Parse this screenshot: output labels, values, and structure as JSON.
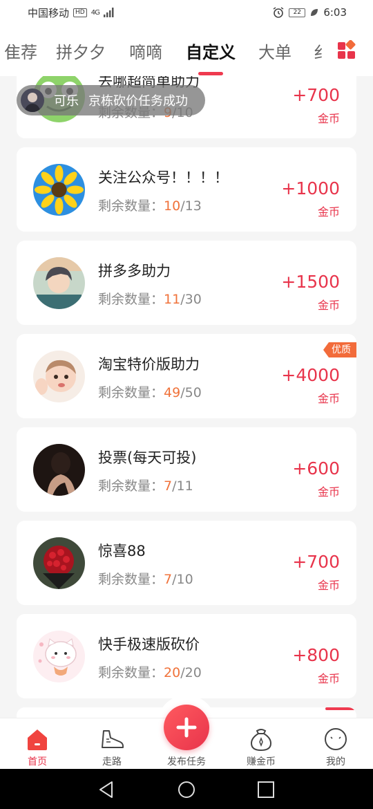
{
  "status_bar": {
    "carrier": "中国移动",
    "hd": "HD",
    "network": "4G",
    "battery": "22",
    "time": "6:03"
  },
  "tabs": [
    {
      "label": "推荐",
      "visible_text": "隹荐"
    },
    {
      "label": "拼夕夕"
    },
    {
      "label": "嘀嘀"
    },
    {
      "label": "自定义",
      "active": true
    },
    {
      "label": "大单"
    },
    {
      "label": "纟"
    }
  ],
  "toast": {
    "user": "可乐",
    "message": "京栋砍价任务成功"
  },
  "tasks": [
    {
      "title": "去哪超简单助力",
      "remaining_label": "剩余数量：",
      "remaining": "9",
      "total": "/10",
      "reward": "+700",
      "unit": "金币",
      "avatar": "frog-avatar"
    },
    {
      "title": "关注公众号！！！！",
      "remaining_label": "剩余数量：",
      "remaining": "10",
      "total": "/13",
      "reward": "+1000",
      "unit": "金币",
      "avatar": "sunflower-avatar"
    },
    {
      "title": "拼多多助力",
      "remaining_label": "剩余数量：",
      "remaining": "11",
      "total": "/30",
      "reward": "+1500",
      "unit": "金币",
      "avatar": "anime-avatar"
    },
    {
      "title": "淘宝特价版助力",
      "remaining_label": "剩余数量：",
      "remaining": "49",
      "total": "/50",
      "reward": "+4000",
      "unit": "金币",
      "badge": "优质",
      "avatar": "baby-avatar"
    },
    {
      "title": "投票(每天可投)",
      "remaining_label": "剩余数量：",
      "remaining": "7",
      "total": "/11",
      "reward": "+600",
      "unit": "金币",
      "avatar": "portrait-avatar"
    },
    {
      "title": "惊喜88",
      "remaining_label": "剩余数量：",
      "remaining": "7",
      "total": "/10",
      "reward": "+700",
      "unit": "金币",
      "avatar": "roses-avatar"
    },
    {
      "title": "快手极速版砍价",
      "remaining_label": "剩余数量：",
      "remaining": "20",
      "total": "/20",
      "reward": "+800",
      "unit": "金币",
      "avatar": "cat-avatar"
    }
  ],
  "bottom_nav": [
    {
      "label": "首页",
      "icon": "home-icon",
      "active": true
    },
    {
      "label": "走路",
      "icon": "shoe-icon"
    },
    {
      "label": "发布任务",
      "icon": "plus-icon"
    },
    {
      "label": "赚金币",
      "icon": "coin-bag-icon"
    },
    {
      "label": "我的",
      "icon": "profile-face-icon"
    }
  ],
  "colors": {
    "accent": "#e8344b",
    "count": "#f0723a",
    "badge": "#f26b3a",
    "background": "#f5f5f5"
  }
}
